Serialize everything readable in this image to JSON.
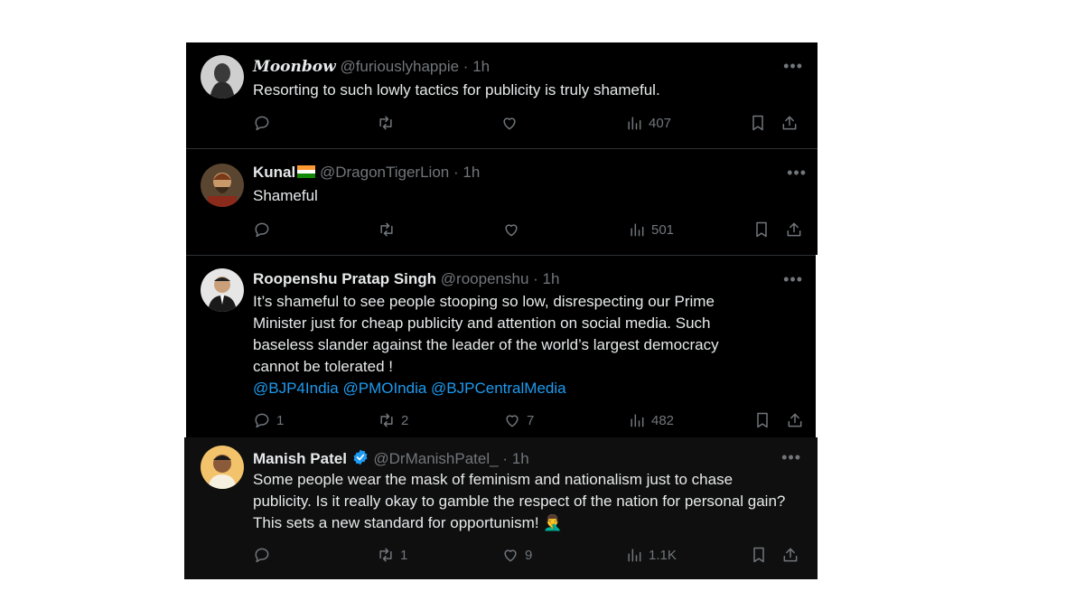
{
  "tweets": [
    {
      "name": "𝑴𝒐𝒐𝒏𝒃𝒐𝒘",
      "handle": "@furiouslyhappie",
      "time": "1h",
      "text": "Resorting to such lowly tactics for publicity is truly shameful.",
      "replies": "",
      "retweets": "",
      "likes": "",
      "views": "407",
      "avatar_color": "#6b6b6b"
    },
    {
      "name": "Kunal",
      "handle": "@DragonTigerLion",
      "time": "1h",
      "text": "Shameful",
      "replies": "",
      "retweets": "",
      "likes": "",
      "views": "501",
      "avatar_color": "#7a5a3a"
    },
    {
      "name": "Roopenshu Pratap Singh",
      "handle": "@roopenshu",
      "time": "1h",
      "text": "It’s shameful to see people stooping so low, disrespecting our Prime Minister just for cheap publicity and attention on social media. Such baseless slander against the leader of the world’s largest democracy cannot be tolerated !",
      "mentions": "@BJP4India @PMOIndia @BJPCentralMedia",
      "replies": "1",
      "retweets": "2",
      "likes": "7",
      "views": "482",
      "avatar_color": "#9a9a9a"
    },
    {
      "name": "Manish Patel",
      "handle": "@DrManishPatel_",
      "time": "1h",
      "text": "Some people wear the mask of feminism and nationalism just to chase publicity. Is it really okay to gamble the respect of the nation for personal gain? This sets a new standard for opportunism! 🤦‍♂️",
      "replies": "",
      "retweets": "1",
      "likes": "9",
      "views": "1.1K",
      "avatar_color": "#d9a55a"
    }
  ],
  "colors": {
    "background": "#000000",
    "text": "#e7e9ea",
    "secondary": "#71767b",
    "link": "#1d9bf0",
    "verified": "#1d9bf0"
  },
  "icons": [
    "reply-icon",
    "retweet-icon",
    "like-icon",
    "views-icon",
    "bookmark-icon",
    "share-icon",
    "more-icon",
    "verified-icon"
  ]
}
